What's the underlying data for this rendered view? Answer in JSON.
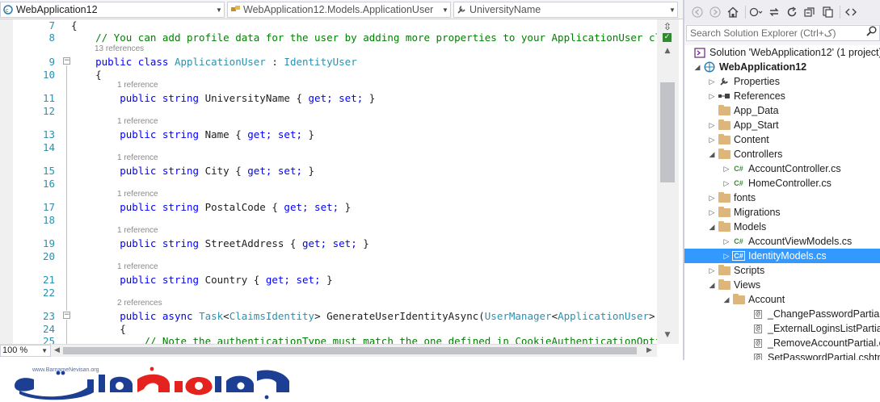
{
  "editor": {
    "nav": {
      "project": "WebApplication12",
      "class": "WebApplication12.Models.ApplicationUser",
      "member": "UniversityName"
    },
    "line_numbers": [
      "7",
      "8",
      "9",
      "10",
      "11",
      "12",
      "13",
      "14",
      "15",
      "16",
      "17",
      "18",
      "19",
      "20",
      "21",
      "22",
      "23",
      "24",
      "25"
    ],
    "code": {
      "open_brace": "{",
      "comment": "// You can add profile data for the user by adding more properties to your ApplicationUser class, p",
      "refs_13": "13 references",
      "class_kw": "public class ",
      "class_name": "ApplicationUser",
      "class_colon": " : ",
      "class_base": "IdentityUser",
      "class_open": "{",
      "ref_1": "1 reference",
      "ref_2": "2 references",
      "props": [
        {
          "kw": "public string ",
          "name": "UniversityName { ",
          "acc": "get; set;",
          "end": " }"
        },
        {
          "kw": "public string ",
          "name": "Name { ",
          "acc": "get; set;",
          "end": " }"
        },
        {
          "kw": "public string ",
          "name": "City { ",
          "acc": "get; set;",
          "end": " }"
        },
        {
          "kw": "public string ",
          "name": "PostalCode { ",
          "acc": "get; set;",
          "end": " }"
        },
        {
          "kw": "public string ",
          "name": "StreetAddress { ",
          "acc": "get; set;",
          "end": " }"
        },
        {
          "kw": "public string ",
          "name": "Country { ",
          "acc": "get; set;",
          "end": " }"
        }
      ],
      "method_kw": "public async ",
      "method_task": "Task",
      "method_lt": "<",
      "method_ci": "ClaimsIdentity",
      "method_gt": "> GenerateUserIdentityAsync(",
      "method_um": "UserManager",
      "method_lt2": "<",
      "method_au": "ApplicationUser",
      "method_rest": "> manager",
      "method_open": "{",
      "note": "// Note the authenticationType must match the one defined in CookieAuthenticationOptions.Au"
    },
    "zoom": "100 %"
  },
  "solution_explorer": {
    "search_placeholder": "Search Solution Explorer (Ctrl+ک)",
    "nodes": [
      {
        "label": "Solution 'WebApplication12' (1 project)"
      },
      {
        "label": "WebApplication12"
      },
      {
        "label": "Properties"
      },
      {
        "label": "References"
      },
      {
        "label": "App_Data"
      },
      {
        "label": "App_Start"
      },
      {
        "label": "Content"
      },
      {
        "label": "Controllers"
      },
      {
        "label": "AccountController.cs"
      },
      {
        "label": "HomeController.cs"
      },
      {
        "label": "fonts"
      },
      {
        "label": "Migrations"
      },
      {
        "label": "Models"
      },
      {
        "label": "AccountViewModels.cs"
      },
      {
        "label": "IdentityModels.cs"
      },
      {
        "label": "Scripts"
      },
      {
        "label": "Views"
      },
      {
        "label": "Account"
      },
      {
        "label": "_ChangePasswordPartial.c"
      },
      {
        "label": "_ExternalLoginsListPartial."
      },
      {
        "label": "_RemoveAccountPartial.c"
      },
      {
        "label": "SetPasswordPartial.cshtm"
      }
    ],
    "cs_badge": "C#",
    "cshtml_badge": "@"
  },
  "footer": {
    "logo_url": "www.BarnameNevisan.org"
  },
  "colors": {
    "keyword": "#0000ff",
    "type": "#2b91af",
    "comment": "#008000",
    "selection": "#3399ff",
    "logo_blue": "#1c3f94",
    "logo_red": "#e4231f"
  },
  "icons": [
    "csharp-project-icon",
    "class-icon",
    "property-wrench-icon",
    "back-arrow-icon",
    "forward-arrow-icon",
    "home-icon",
    "sync-icon",
    "pending-changes-icon",
    "refresh-icon",
    "collapse-all-icon",
    "show-all-files-icon",
    "code-view-icon",
    "search-icon",
    "folder-icon",
    "csharp-file-icon",
    "cshtml-file-icon",
    "solution-icon",
    "references-icon"
  ]
}
